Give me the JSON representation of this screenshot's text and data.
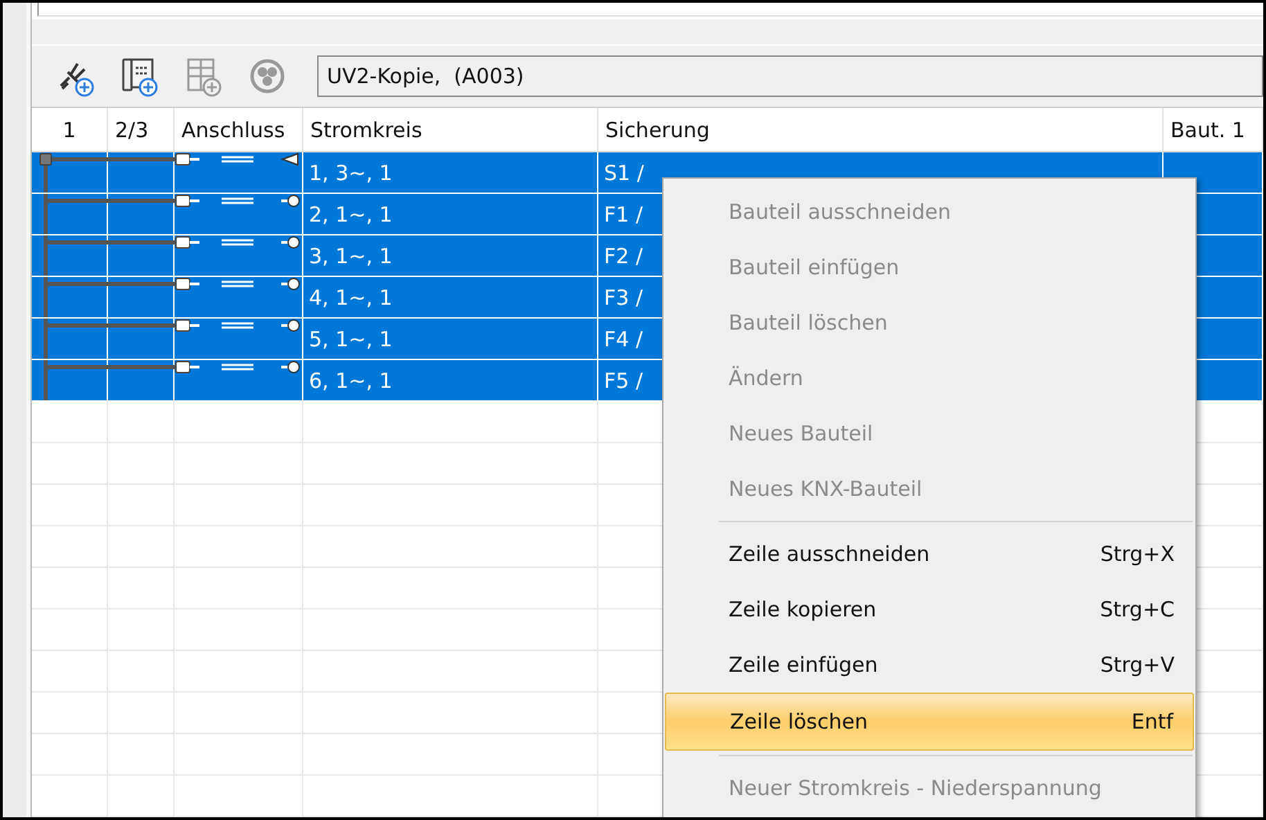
{
  "toolbar": {
    "buttons": [
      {
        "kind": "plug-add",
        "disabled": false
      },
      {
        "kind": "panel-add",
        "disabled": false
      },
      {
        "kind": "grid-add",
        "disabled": true
      },
      {
        "kind": "circle",
        "disabled": true
      }
    ],
    "field": {
      "value": "UV2-Kopie,  (A003)"
    }
  },
  "table": {
    "columns": [
      "1",
      "2/3",
      "Anschluss",
      "Stromkreis",
      "Sicherung",
      "Baut. 1"
    ],
    "rows": [
      {
        "kind": "main",
        "selected": true,
        "stromkreis": "1, 3~, 1",
        "sicherung": "S1 /"
      },
      {
        "kind": "branch",
        "selected": true,
        "stromkreis": "2, 1~, 1",
        "sicherung": "F1 /"
      },
      {
        "kind": "branch",
        "selected": true,
        "stromkreis": "3, 1~, 1",
        "sicherung": "F2 /"
      },
      {
        "kind": "branch",
        "selected": true,
        "stromkreis": "4, 1~, 1",
        "sicherung": "F3 /"
      },
      {
        "kind": "branch",
        "selected": true,
        "stromkreis": "5, 1~, 1",
        "sicherung": "F4 /"
      },
      {
        "kind": "branch",
        "selected": true,
        "stromkreis": "6, 1~, 1",
        "sicherung": "F5 /"
      }
    ]
  },
  "context_menu": {
    "items": [
      {
        "kind": "item",
        "label": "Bauteil ausschneiden",
        "disabled": true,
        "selected": false
      },
      {
        "kind": "item",
        "label": "Bauteil einfügen",
        "disabled": true,
        "selected": false
      },
      {
        "kind": "item",
        "label": "Bauteil löschen",
        "disabled": true,
        "selected": false
      },
      {
        "kind": "item",
        "label": "Ändern",
        "disabled": true,
        "selected": false
      },
      {
        "kind": "item",
        "label": "Neues Bauteil",
        "disabled": true,
        "selected": false
      },
      {
        "kind": "item",
        "label": "Neues KNX-Bauteil",
        "disabled": true,
        "selected": false
      },
      {
        "kind": "separator"
      },
      {
        "kind": "item",
        "label": "Zeile ausschneiden",
        "shortcut": "Strg+X",
        "disabled": false,
        "selected": false
      },
      {
        "kind": "item",
        "label": "Zeile kopieren",
        "shortcut": "Strg+C",
        "disabled": false,
        "selected": false
      },
      {
        "kind": "item",
        "label": "Zeile einfügen",
        "shortcut": "Strg+V",
        "disabled": false,
        "selected": false
      },
      {
        "kind": "item",
        "label": "Zeile löschen",
        "shortcut": "Entf",
        "disabled": false,
        "selected": true
      },
      {
        "kind": "separator"
      },
      {
        "kind": "item",
        "label": "Neuer Stromkreis - Niederspannung",
        "disabled": true,
        "selected": false
      }
    ]
  }
}
